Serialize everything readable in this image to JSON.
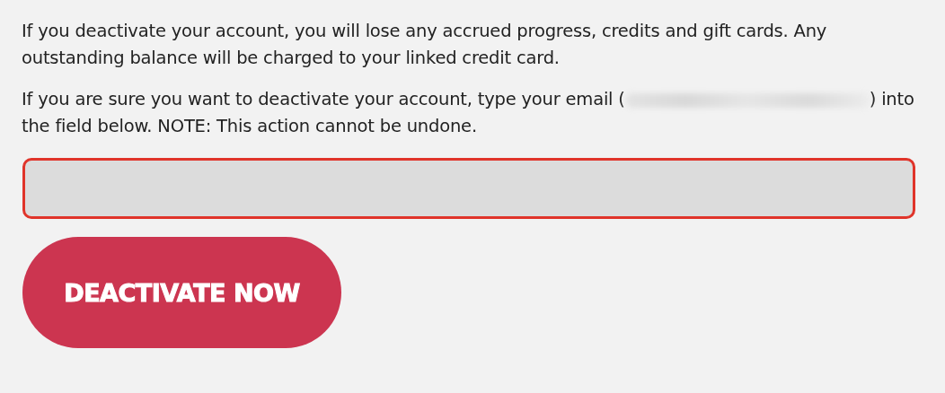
{
  "warning": "If you deactivate your account, you will lose any accrued progress, credits and gift cards. Any outstanding balance will be charged to your linked credit card.",
  "instruction": {
    "before_email": "If you are sure you want to deactivate your account, type your email (",
    "after_email": ") into the field below. NOTE: This action cannot be undone."
  },
  "email_field": {
    "error": true
  },
  "button": {
    "label": "DEACTIVATE NOW"
  }
}
